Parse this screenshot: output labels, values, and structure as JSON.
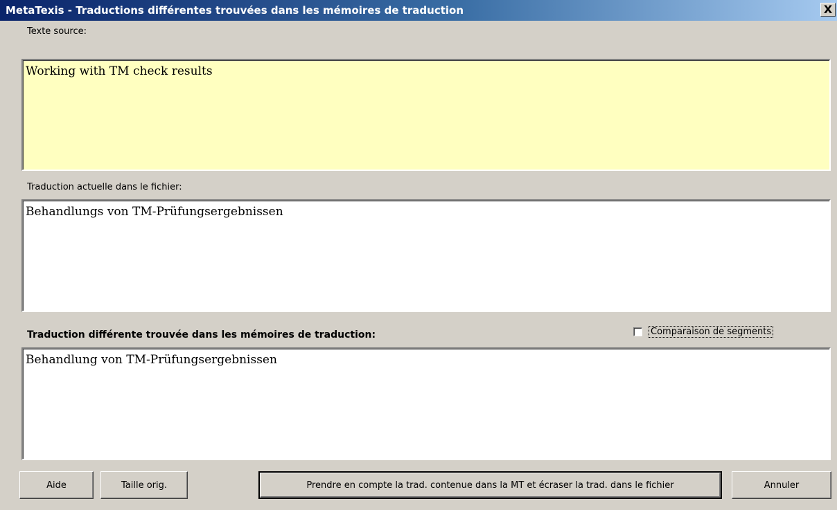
{
  "window": {
    "title": "MetaTexis - Traductions différentes trouvées dans les mémoires de traduction",
    "close_label": "X"
  },
  "source": {
    "label": "Texte source:",
    "text": "Working with TM check results"
  },
  "current": {
    "label": "Traduction actuelle dans le fichier:",
    "text": "Behandlungs von TM-Prüfungsergebnissen"
  },
  "different": {
    "label": "Traduction différente trouvée dans les mémoires de traduction:",
    "text": "Behandlung von TM-Prüfungsergebnissen",
    "compare_checkbox": {
      "label": "Comparaison de segments",
      "checked": false
    }
  },
  "buttons": {
    "help": "Aide",
    "orig_size": "Taille orig.",
    "accept": "Prendre en compte la trad. contenue dans la MT et écraser la trad. dans le fichier",
    "cancel": "Annuler"
  },
  "colors": {
    "source_bg": "#ffffc0",
    "titlebar_start": "#0a246a",
    "dialog_bg": "#d4d0c8"
  }
}
